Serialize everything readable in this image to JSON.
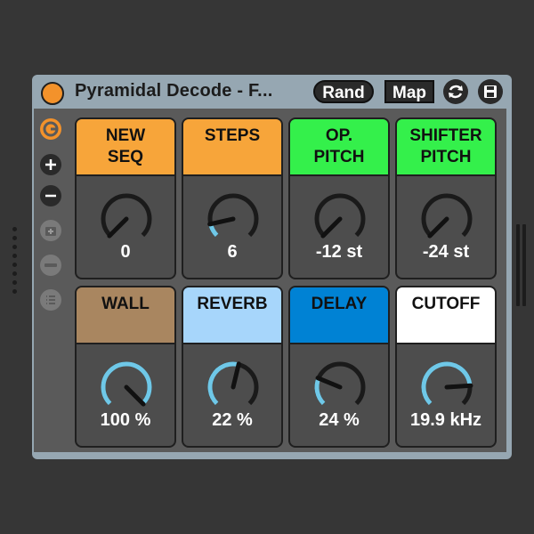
{
  "device": {
    "title": "Pyramidal Decode - F...",
    "rand_label": "Rand",
    "map_label": "Map",
    "power_color": "#f3922b",
    "body_color": "#96a7b2"
  },
  "icons": {
    "title": [
      "power-icon",
      "refresh-icon",
      "save-icon"
    ],
    "sidebar": [
      "sequencer-logo-icon",
      "plus-icon",
      "minus-icon",
      "add-preset-icon",
      "remove-icon",
      "list-icon"
    ]
  },
  "knobs": [
    {
      "header": "NEW\nSEQ",
      "value": "0",
      "color": "#f7a53a",
      "level": 0.0
    },
    {
      "header": "STEPS",
      "value": "6",
      "color": "#f7a53a",
      "level": 0.12
    },
    {
      "header": "OP.\nPITCH",
      "value": "-12 st",
      "color": "#34f04b",
      "level": 0.0
    },
    {
      "header": "SHIFTER\nPITCH",
      "value": "-24 st",
      "color": "#34f04b",
      "level": 0.0
    },
    {
      "header": "WALL",
      "value": "100 %",
      "color": "#a98660",
      "level": 1.0
    },
    {
      "header": "REVERB",
      "value": "22 %",
      "color": "#a7d6fb",
      "level": 0.55
    },
    {
      "header": "DELAY",
      "value": "24 %",
      "color": "#0082d4",
      "level": 0.25
    },
    {
      "header": "CUTOFF",
      "value": "19.9 kHz",
      "color": "#ffffff",
      "level": 0.82
    }
  ],
  "knob_style": {
    "arc_color": "#6fc8e8",
    "track_color": "#1a1a1a"
  }
}
